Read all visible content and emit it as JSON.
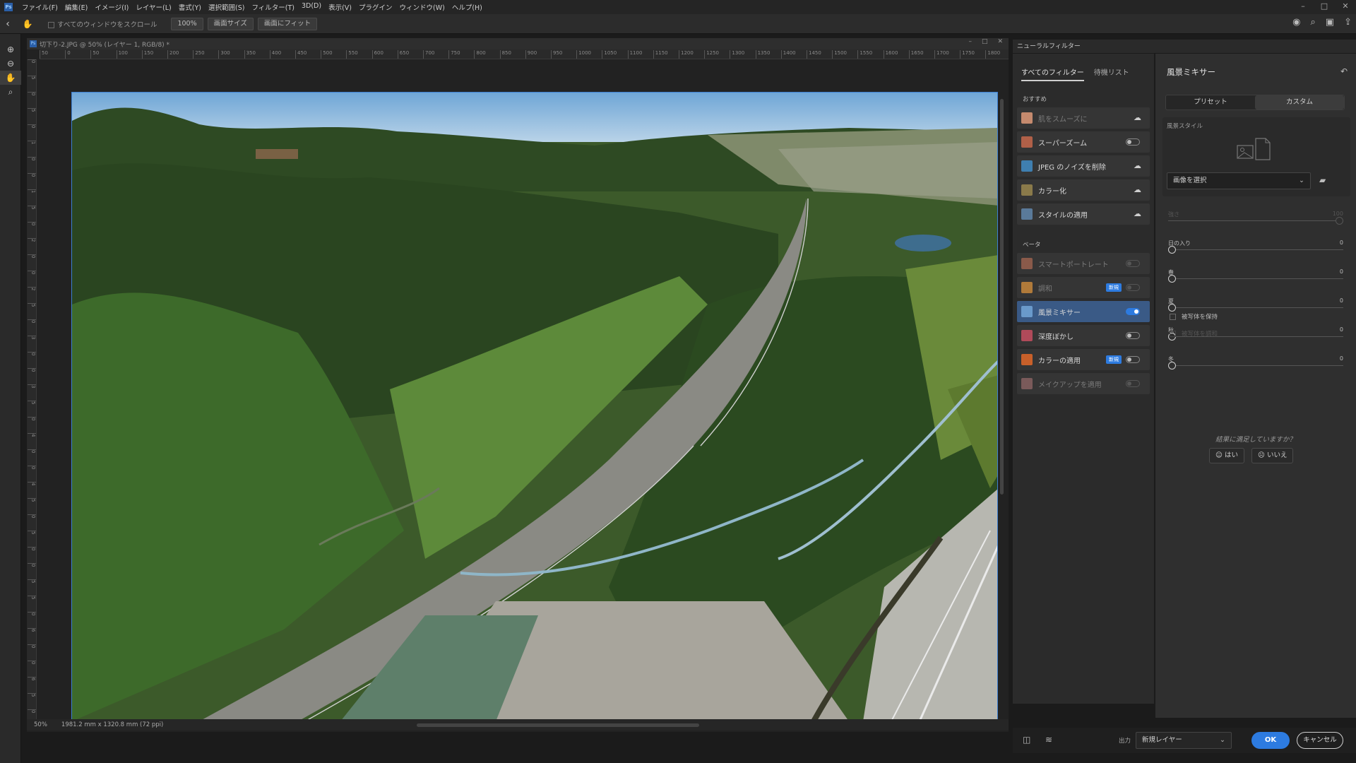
{
  "menu": [
    "ファイル(F)",
    "編集(E)",
    "イメージ(I)",
    "レイヤー(L)",
    "書式(Y)",
    "選択範囲(S)",
    "フィルター(T)",
    "3D(D)",
    "表示(V)",
    "プラグイン",
    "ウィンドウ(W)",
    "ヘルプ(H)"
  ],
  "options": {
    "scroll_all": "すべてのウィンドウをスクロール",
    "zoom100": "100%",
    "fit_screen": "画面サイズ",
    "fill_screen": "画面にフィット"
  },
  "document": {
    "title": "切下り-2.JPG @ 50% (レイヤー 1, RGB/8) *",
    "zoom": "50%",
    "size": "1981.2 mm x 1320.8 mm (72 ppi)"
  },
  "ruler": {
    "h": [
      "50",
      "0",
      "50",
      "100",
      "150",
      "200",
      "250",
      "300",
      "350",
      "400",
      "450",
      "500",
      "550",
      "600",
      "650",
      "700",
      "750",
      "800",
      "850",
      "900",
      "950",
      "1000",
      "1050",
      "1100",
      "1150",
      "1200",
      "1250",
      "1300",
      "1350",
      "1400",
      "1450",
      "1500",
      "1550",
      "1600",
      "1650",
      "1700",
      "1750",
      "1800"
    ],
    "v": [
      "0",
      "5",
      "0",
      "5",
      "0",
      "1",
      "0",
      "0",
      "1",
      "5",
      "0",
      "2",
      "0",
      "0",
      "2",
      "5",
      "0",
      "3",
      "0",
      "0",
      "3",
      "5",
      "0",
      "4",
      "0",
      "0",
      "4",
      "5",
      "0",
      "5",
      "0",
      "0",
      "5",
      "5",
      "0",
      "6",
      "0",
      "0",
      "6",
      "5",
      "0"
    ]
  },
  "neural": {
    "header": "ニューラルフィルター",
    "tabs": [
      "すべてのフィルター",
      "待機リスト"
    ],
    "section_featured": "おすすめ",
    "featured": [
      {
        "label": "肌をスムーズに",
        "state": "cloud",
        "dim": true,
        "color": "#c58a6e"
      },
      {
        "label": "スーパーズーム",
        "state": "off",
        "dim": false,
        "color": "#b06048"
      },
      {
        "label": "JPEG のノイズを削除",
        "state": "cloud",
        "dim": false,
        "color": "#3f7fb0"
      },
      {
        "label": "カラー化",
        "state": "cloud",
        "dim": false,
        "color": "#8a7a4a"
      },
      {
        "label": "スタイルの適用",
        "state": "cloud",
        "dim": false,
        "color": "#5a7a9a"
      }
    ],
    "section_beta": "ベータ",
    "beta": [
      {
        "label": "スマートポートレート",
        "state": "off-dim",
        "dim": true,
        "badge": "",
        "color": "#8a5a4a"
      },
      {
        "label": "調和",
        "state": "off-dim",
        "dim": true,
        "badge": "新規",
        "color": "#b07a3a"
      },
      {
        "label": "風景ミキサー",
        "state": "on",
        "dim": false,
        "badge": "",
        "color": "#6a9acb"
      },
      {
        "label": "深度ぼかし",
        "state": "off",
        "dim": false,
        "badge": "",
        "color": "#b04a5a"
      },
      {
        "label": "カラーの適用",
        "state": "off",
        "dim": false,
        "badge": "新規",
        "color": "#c8602a"
      },
      {
        "label": "メイクアップを適用",
        "state": "off-dim",
        "dim": true,
        "badge": "",
        "color": "#7a5a5a"
      }
    ]
  },
  "settings": {
    "title": "風景ミキサー",
    "seg": [
      "プリセット",
      "カスタム"
    ],
    "style_label": "風景スタイル",
    "select_image": "画像を選択",
    "sliders": [
      {
        "label": "強さ",
        "value": "100",
        "level": 1.0,
        "dim": true
      },
      {
        "label": "日の入り",
        "value": "0",
        "level": 0,
        "dim": false
      },
      {
        "label": "春",
        "value": "0",
        "level": 0,
        "dim": false
      },
      {
        "label": "夏",
        "value": "0",
        "level": 0,
        "dim": false
      },
      {
        "label": "秋",
        "value": "0",
        "level": 0,
        "dim": false
      },
      {
        "label": "冬",
        "value": "0",
        "level": 0,
        "dim": false
      }
    ],
    "preserve": "被写体を保持",
    "harmonize": "被写体を調和",
    "satisfy": "結果に満足していますか？",
    "yes": "はい",
    "no": "いいえ"
  },
  "footer": {
    "output_label": "出力",
    "output_value": "新規レイヤー",
    "ok": "OK",
    "cancel": "キャンセル"
  },
  "colors": {
    "accent": "#2d7be0",
    "sky": "#7fb3de",
    "forest": "#2f4a22"
  }
}
